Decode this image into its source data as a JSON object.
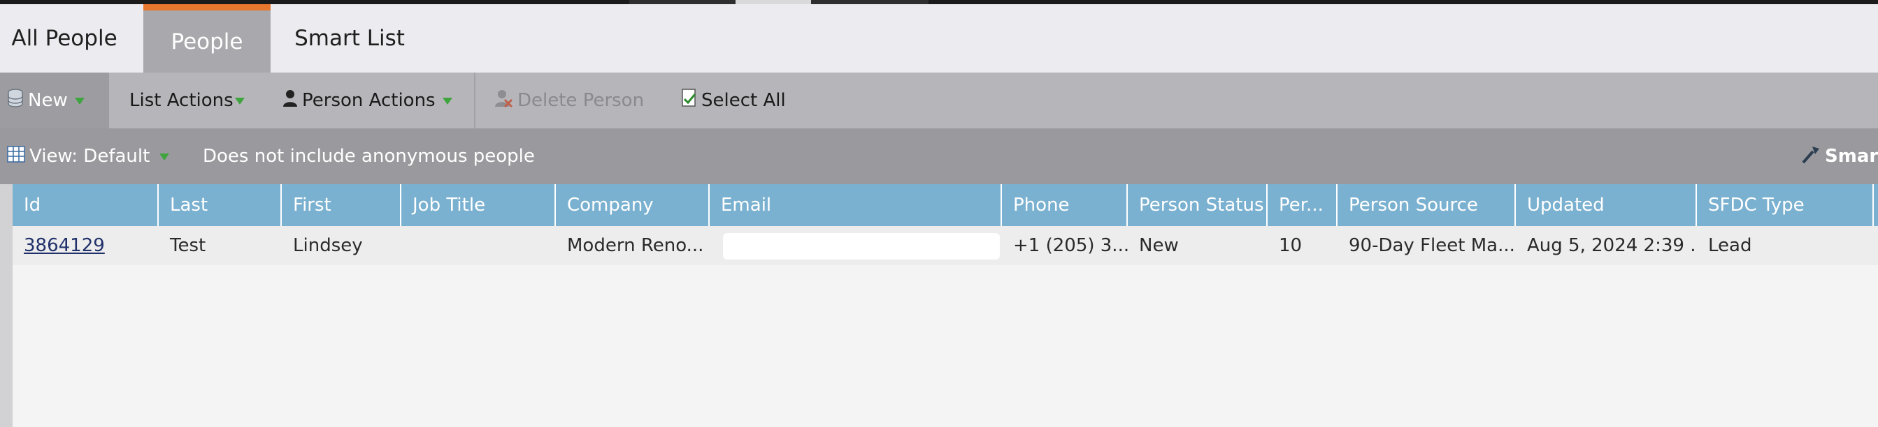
{
  "tabs": [
    {
      "label": "All People",
      "active": false
    },
    {
      "label": "People",
      "active": true
    },
    {
      "label": "Smart List",
      "active": false
    }
  ],
  "toolbar": {
    "new_label": "New",
    "list_actions_label": "List Actions",
    "person_actions_label": "Person Actions",
    "delete_person_label": "Delete Person",
    "select_all_label": "Select All"
  },
  "viewbar": {
    "view_label": "View: Default",
    "filter_note": "Does not include anonymous people",
    "smart_label": "Smart"
  },
  "table": {
    "columns": [
      "Id",
      "Last",
      "First",
      "Job Title",
      "Company",
      "Email",
      "Phone",
      "Person Status",
      "Per...",
      "Person Source",
      "Updated",
      "SFDC Type"
    ],
    "rows": [
      {
        "id": "3864129",
        "last": "Test",
        "first": "Lindsey",
        "job_title": "",
        "company": "Modern Reno...",
        "email": "",
        "phone": "+1 (205) 3...",
        "person_status": "New",
        "per": "10",
        "person_source": "90-Day Fleet Ma...",
        "updated": "Aug 5, 2024 2:39 ...",
        "sfdc_type": "Lead"
      }
    ]
  },
  "colors": {
    "active_tab_accent": "#e8772e",
    "header_blue": "#7bb1d0",
    "dropdown_green": "#3ea53e"
  },
  "icons": {
    "new": "database-icon",
    "person_actions": "person-icon",
    "delete_person": "delete-person-icon",
    "select_all": "checklist-icon",
    "view": "grid-view-icon",
    "smart": "wand-icon"
  }
}
